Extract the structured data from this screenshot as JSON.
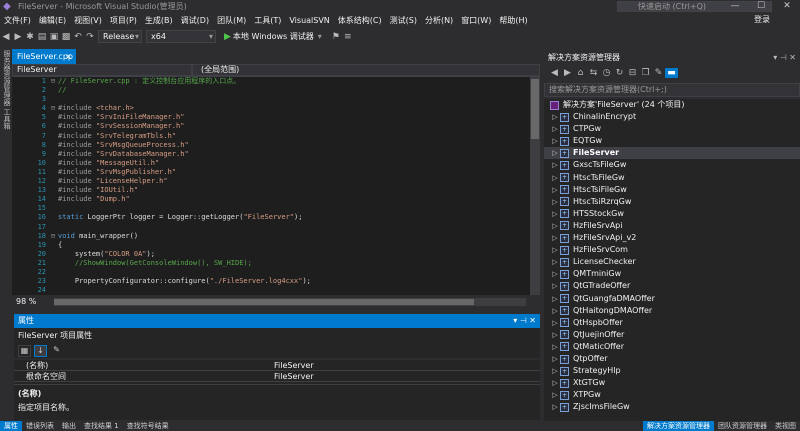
{
  "window": {
    "title": "FileServer - Microsoft Visual Studio(管理员)",
    "quick_launch": "快速启动 (Ctrl+Q)",
    "login": "登录"
  },
  "menu": [
    "文件(F)",
    "编辑(E)",
    "视图(V)",
    "项目(P)",
    "生成(B)",
    "调试(D)",
    "团队(M)",
    "工具(T)",
    "VisualSVN",
    "体系结构(C)",
    "测试(S)",
    "分析(N)",
    "窗口(W)",
    "帮助(H)"
  ],
  "toolbar": {
    "config": "Release",
    "platform": "x64",
    "run_label": "本地 Windows 调试器"
  },
  "side_tabs": "服务器资源管理器   工具箱",
  "editor": {
    "tab": "FileServer.cpp",
    "tab_close": "×",
    "scope_combo": "FileServer",
    "member_combo": "(全局范围)",
    "zoom": "98 %",
    "lines": [
      {
        "n": "1",
        "fold": "⊟",
        "text": "// FileServer.cpp : 定义控制台应用程序的入口点。",
        "kind": "comment"
      },
      {
        "n": "2",
        "fold": "",
        "text": "//",
        "kind": "comment"
      },
      {
        "n": "3",
        "fold": "",
        "text": "",
        "kind": "plain"
      },
      {
        "n": "4",
        "fold": "⊟",
        "text": "#include <tchar.h>",
        "kind": "include"
      },
      {
        "n": "5",
        "fold": "",
        "text": "#include \"SrvIniFileManager.h\"",
        "kind": "include"
      },
      {
        "n": "6",
        "fold": "",
        "text": "#include \"SrvSessionManager.h\"",
        "kind": "include"
      },
      {
        "n": "7",
        "fold": "",
        "text": "#include \"SrvTelegramTbls.h\"",
        "kind": "include"
      },
      {
        "n": "8",
        "fold": "",
        "text": "#include \"SrvMsgQueueProcess.h\"",
        "kind": "include"
      },
      {
        "n": "9",
        "fold": "",
        "text": "#include \"SrvDatabaseManager.h\"",
        "kind": "include"
      },
      {
        "n": "10",
        "fold": "",
        "text": "#include \"MessageUtil.h\"",
        "kind": "include"
      },
      {
        "n": "11",
        "fold": "",
        "text": "#include \"SrvMsgPublisher.h\"",
        "kind": "include"
      },
      {
        "n": "12",
        "fold": "",
        "text": "#include \"LicenseHelper.h\"",
        "kind": "include"
      },
      {
        "n": "13",
        "fold": "",
        "text": "#include \"IOUtil.h\"",
        "kind": "include"
      },
      {
        "n": "14",
        "fold": "",
        "text": "#include \"Dump.h\"",
        "kind": "include"
      },
      {
        "n": "15",
        "fold": "",
        "text": "",
        "kind": "plain"
      },
      {
        "n": "16",
        "fold": "",
        "text": "static LoggerPtr logger = Logger::getLogger(\"FileServer\");",
        "kind": "plain"
      },
      {
        "n": "17",
        "fold": "",
        "text": "",
        "kind": "plain"
      },
      {
        "n": "18",
        "fold": "⊟",
        "text": "void main_wrapper()",
        "kind": "plain"
      },
      {
        "n": "19",
        "fold": "",
        "text": "{",
        "kind": "plain"
      },
      {
        "n": "20",
        "fold": "",
        "text": "    system(\"COLOR 0A\");",
        "kind": "plain"
      },
      {
        "n": "21",
        "fold": "",
        "text": "    //ShowWindow(GetConsoleWindow(), SW_HIDE);",
        "kind": "comment"
      },
      {
        "n": "22",
        "fold": "",
        "text": "",
        "kind": "plain"
      },
      {
        "n": "23",
        "fold": "",
        "text": "    PropertyConfigurator::configure(\"./FileServer.log4cxx\");",
        "kind": "plain"
      },
      {
        "n": "24",
        "fold": "",
        "text": "",
        "kind": "plain"
      }
    ]
  },
  "properties": {
    "panel_title": "属性",
    "object": "FileServer 项目属性",
    "rows": [
      {
        "key": "(名称)",
        "value": "FileServer"
      },
      {
        "key": "根命名空间",
        "value": "FileServer"
      }
    ],
    "desc_title": "(名称)",
    "desc_text": "指定项目名称。"
  },
  "bottom_tabs": [
    "属性",
    "错误列表",
    "输出",
    "查找结果 1",
    "查找符号结果"
  ],
  "bottom_right_tabs": [
    "解决方案资源管理器",
    "团队资源管理器",
    "类视图"
  ],
  "solution_explorer": {
    "title": "解决方案资源管理器",
    "search_placeholder": "搜索解决方案资源管理器(Ctrl+;)",
    "solution": "解决方案'FileServer' (24 个项目)",
    "projects": [
      "ChinalinEncrypt",
      "CTPGw",
      "EQTGw",
      "FileServer",
      "GxscTsFileGw",
      "HtscTsFileGw",
      "HtscTsiFileGw",
      "HtscTsiRzrqGw",
      "HTSStockGw",
      "HzFileSrvApi",
      "HzFileSrvApi_v2",
      "HzFileSrvCom",
      "LicenseChecker",
      "QMTminiGw",
      "QtGTradeOffer",
      "QtGuangfaDMAOffer",
      "QtHaitongDMAOffer",
      "QtHspbOffer",
      "QtJuejinOffer",
      "QtMaticOffer",
      "QtpOffer",
      "StrategyHlp",
      "XtGTGw",
      "XTPGw",
      "ZjscImsFileGw"
    ],
    "selected": "FileServer"
  },
  "colors": {
    "accent": "#007acc",
    "keyword": "#569cd6",
    "string": "#d69d85",
    "comment": "#57a64a",
    "preprocessor": "#9b9b9b",
    "linenum": "#2b91af"
  }
}
